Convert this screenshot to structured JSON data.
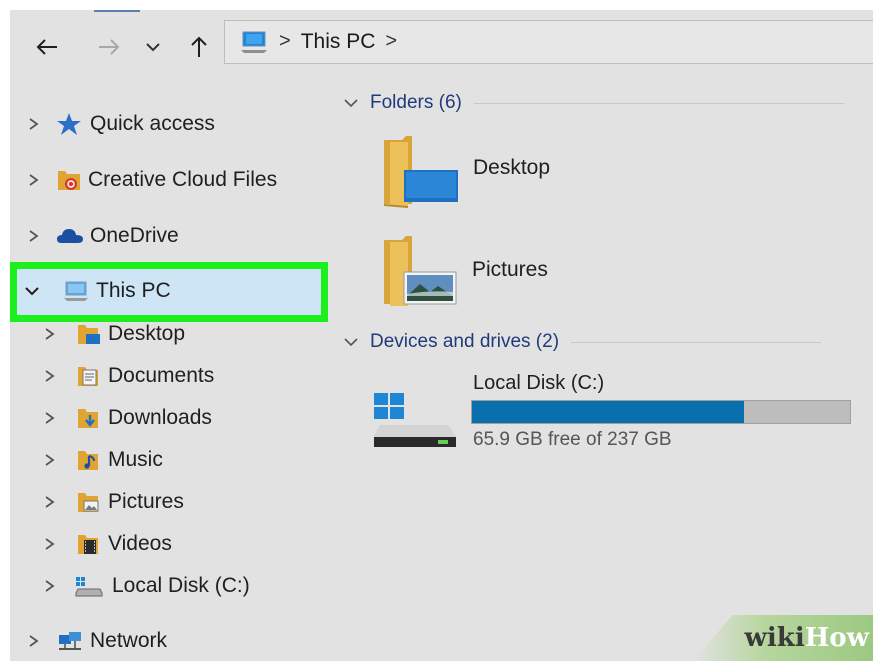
{
  "address_bar": {
    "breadcrumb": "This PC",
    "separator": ">"
  },
  "sidebar": {
    "items": [
      {
        "label": "Quick access",
        "icon": "star-icon"
      },
      {
        "label": "Creative Cloud Files",
        "icon": "creative-cloud-folder-icon"
      },
      {
        "label": "OneDrive",
        "icon": "cloud-icon"
      },
      {
        "label": "This PC",
        "icon": "computer-icon",
        "expanded": true,
        "selected": true
      },
      {
        "label": "Desktop",
        "icon": "desktop-folder-icon"
      },
      {
        "label": "Documents",
        "icon": "documents-folder-icon"
      },
      {
        "label": "Downloads",
        "icon": "downloads-folder-icon"
      },
      {
        "label": "Music",
        "icon": "music-folder-icon"
      },
      {
        "label": "Pictures",
        "icon": "pictures-folder-icon"
      },
      {
        "label": "Videos",
        "icon": "videos-folder-icon"
      },
      {
        "label": "Local Disk (C:)",
        "icon": "drive-icon"
      },
      {
        "label": "Network",
        "icon": "network-icon"
      }
    ]
  },
  "main": {
    "folders_header": "Folders (6)",
    "folders": [
      {
        "label": "Desktop",
        "icon": "desktop-folder-icon"
      },
      {
        "label": "Pictures",
        "icon": "pictures-folder-icon"
      }
    ],
    "devices_header": "Devices and drives (2)",
    "drive": {
      "name": "Local Disk (C:)",
      "free_text": "65.9 GB free of 237 GB",
      "used_fraction": 0.72
    }
  },
  "watermark": {
    "part1": "wiki",
    "part2": "How"
  },
  "colors": {
    "highlight_border": "#1cf01c",
    "selection_fill": "#cde5f5",
    "bar_fill": "#0a6fad",
    "group_header": "#1f3b7a"
  }
}
